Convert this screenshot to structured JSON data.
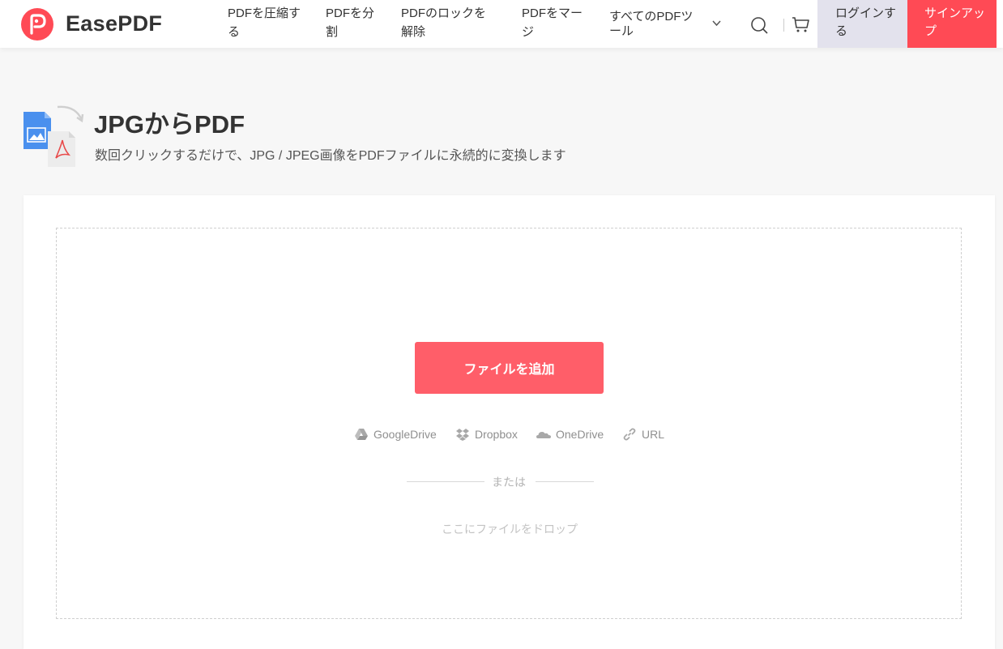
{
  "header": {
    "brand": "EasePDF",
    "nav": [
      "PDFを圧縮する",
      "PDFを分割",
      "PDFのロックを解除",
      "PDFをマージ",
      "すべてのPDFツール"
    ],
    "login_label": "ログインする",
    "signup_label": "サインアップ"
  },
  "page": {
    "title": "JPGからPDF",
    "subtitle": "数回クリックするだけで、JPG / JPEG画像をPDFファイルに永続的に変換します"
  },
  "upload": {
    "add_file_label": "ファイルを追加",
    "sources": [
      "GoogleDrive",
      "Dropbox",
      "OneDrive",
      "URL"
    ],
    "or_label": "または",
    "drop_label": "ここにファイルをドロップ"
  },
  "colors": {
    "brand_red": "#ff4a55",
    "button_red": "#ff5e69",
    "login_bg": "#e3e2ed",
    "jpg_blue": "#4a90ee"
  },
  "icons": [
    "logo-icon",
    "chevron-down-icon",
    "search-icon",
    "cart-icon",
    "jpg-file-icon",
    "pdf-file-icon",
    "google-drive-icon",
    "dropbox-icon",
    "onedrive-icon",
    "link-icon"
  ]
}
